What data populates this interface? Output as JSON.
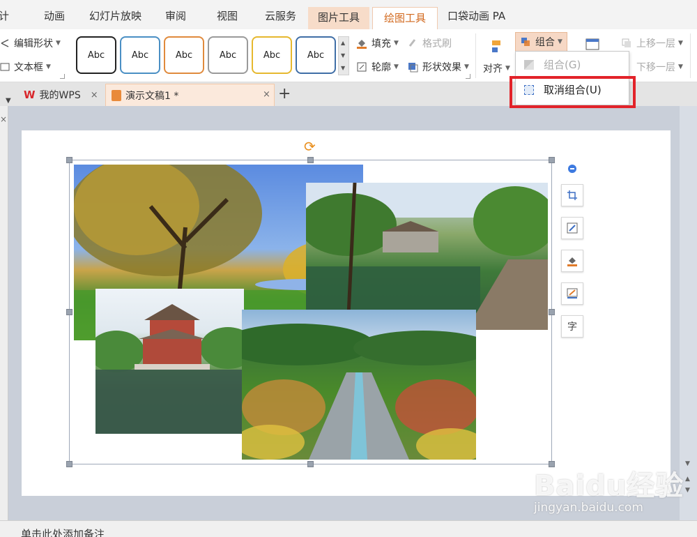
{
  "menu": {
    "tabs": [
      {
        "label": "计"
      },
      {
        "label": "动画"
      },
      {
        "label": "幻灯片放映"
      },
      {
        "label": "审阅"
      },
      {
        "label": "视图"
      },
      {
        "label": "云服务"
      },
      {
        "label": "图片工具"
      },
      {
        "label": "绘图工具"
      },
      {
        "label": "口袋动画 PA"
      }
    ],
    "active_color": "#d2691e"
  },
  "ribbon": {
    "edit_shape": "编辑形状",
    "text_box": "文本框",
    "shape_styles": [
      "Abc",
      "Abc",
      "Abc",
      "Abc",
      "Abc",
      "Abc"
    ],
    "style_colors": [
      "#222222",
      "#4a8fc4",
      "#e08a3c",
      "#9a9a9a",
      "#e6b82e",
      "#3f6ea6"
    ],
    "fill": "填充",
    "format_painter": "格式刷",
    "outline": "轮廓",
    "shape_effects": "形状效果",
    "align": "对齐",
    "group": "组合",
    "bring_forward": "上移一层",
    "send_backward": "下移一层"
  },
  "dropdown": {
    "group_item": "组合(G)",
    "ungroup_item": "取消组合(U)"
  },
  "doc_tabs": {
    "home_tab": "我的WPS",
    "doc_tab": "演示文稿1 *",
    "close_glyph": "×",
    "add_glyph": "+"
  },
  "side_tools": {
    "text_tool_glyph": "字"
  },
  "notes": {
    "placeholder": "单击此处添加备注"
  },
  "watermark": {
    "logo": "Baidu经验",
    "url": "jingyan.baidu.com"
  }
}
